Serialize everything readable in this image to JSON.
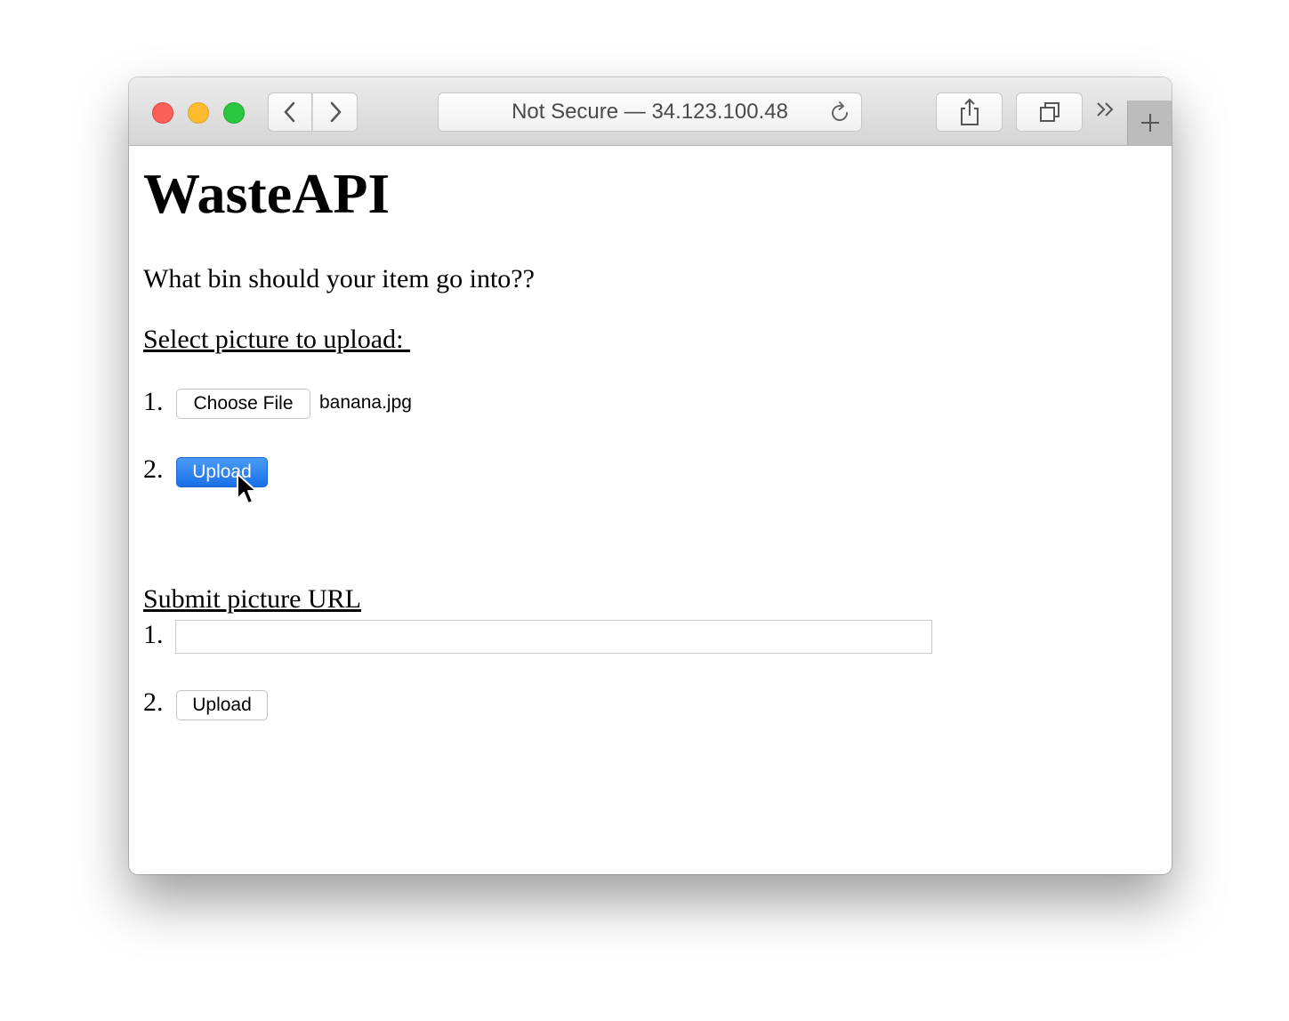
{
  "browser": {
    "address": "Not Secure — 34.123.100.48",
    "icons": [
      "back-icon",
      "forward-icon",
      "reload-icon",
      "share-icon",
      "tabs-icon",
      "chevrons-icon",
      "plus-icon"
    ]
  },
  "page": {
    "title": "WasteAPI",
    "question": "What bin should your item go into??",
    "upload_section": {
      "heading": "Select picture to upload: ",
      "step1_num": "1.",
      "choose_label": "Choose File",
      "filename": "banana.jpg",
      "step2_num": "2.",
      "upload_label": "Upload"
    },
    "url_section": {
      "heading": "Submit picture URL",
      "step1_num": "1.",
      "url_value": "",
      "step2_num": "2.",
      "upload_label": "Upload"
    }
  },
  "colors": {
    "primary_button": "#1a6fe8",
    "close": "#fc5f57",
    "minimize": "#fdbc2e",
    "zoom": "#28c840"
  }
}
